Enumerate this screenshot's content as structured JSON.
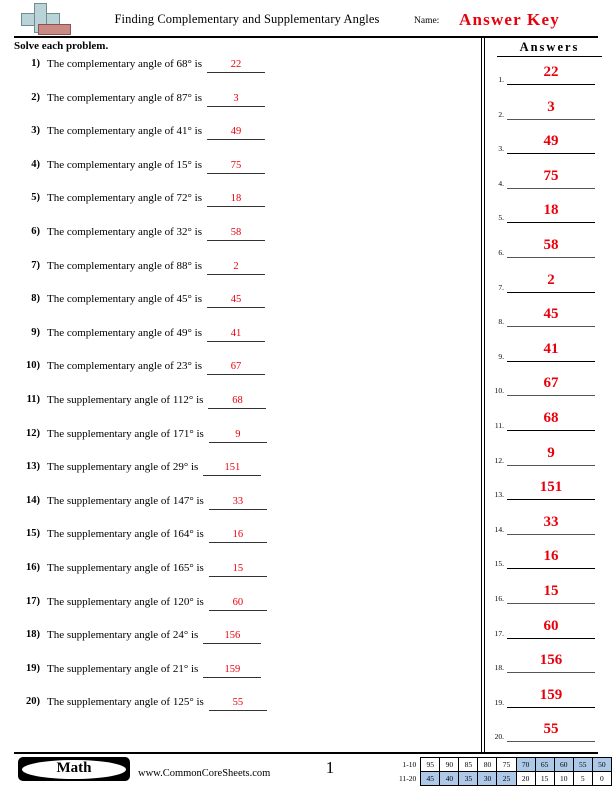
{
  "header": {
    "title": "Finding Complementary and Supplementary Angles",
    "name_label": "Name:",
    "name_value": "Answer Key",
    "logo_name": "commoncoresheets-plus-logo"
  },
  "subheader": {
    "instructions": "Solve each problem.",
    "answers_heading": "Answers"
  },
  "problems": [
    {
      "num": "1)",
      "text": "The complementary angle of 68° is",
      "answer": "22"
    },
    {
      "num": "2)",
      "text": "The complementary angle of 87° is",
      "answer": "3"
    },
    {
      "num": "3)",
      "text": "The complementary angle of 41° is",
      "answer": "49"
    },
    {
      "num": "4)",
      "text": "The complementary angle of 15° is",
      "answer": "75"
    },
    {
      "num": "5)",
      "text": "The complementary angle of 72° is",
      "answer": "18"
    },
    {
      "num": "6)",
      "text": "The complementary angle of 32° is",
      "answer": "58"
    },
    {
      "num": "7)",
      "text": "The complementary angle of 88° is",
      "answer": "2"
    },
    {
      "num": "8)",
      "text": "The complementary angle of 45° is",
      "answer": "45"
    },
    {
      "num": "9)",
      "text": "The complementary angle of 49° is",
      "answer": "41"
    },
    {
      "num": "10)",
      "text": "The complementary angle of 23° is",
      "answer": "67"
    },
    {
      "num": "11)",
      "text": "The supplementary angle of 112° is",
      "answer": "68"
    },
    {
      "num": "12)",
      "text": "The supplementary angle of 171° is",
      "answer": "9"
    },
    {
      "num": "13)",
      "text": "The supplementary angle of 29° is",
      "answer": "151"
    },
    {
      "num": "14)",
      "text": "The supplementary angle of 147° is",
      "answer": "33"
    },
    {
      "num": "15)",
      "text": "The supplementary angle of 164° is",
      "answer": "16"
    },
    {
      "num": "16)",
      "text": "The supplementary angle of 165° is",
      "answer": "15"
    },
    {
      "num": "17)",
      "text": "The supplementary angle of 120° is",
      "answer": "60"
    },
    {
      "num": "18)",
      "text": "The supplementary angle of 24° is",
      "answer": "156"
    },
    {
      "num": "19)",
      "text": "The supplementary angle of 21° is",
      "answer": "159"
    },
    {
      "num": "20)",
      "text": "The supplementary angle of 125° is",
      "answer": "55"
    }
  ],
  "answer_column": [
    {
      "num": "1.",
      "value": "22"
    },
    {
      "num": "2.",
      "value": "3"
    },
    {
      "num": "3.",
      "value": "49"
    },
    {
      "num": "4.",
      "value": "75"
    },
    {
      "num": "5.",
      "value": "18"
    },
    {
      "num": "6.",
      "value": "58"
    },
    {
      "num": "7.",
      "value": "2"
    },
    {
      "num": "8.",
      "value": "45"
    },
    {
      "num": "9.",
      "value": "41"
    },
    {
      "num": "10.",
      "value": "67"
    },
    {
      "num": "11.",
      "value": "68"
    },
    {
      "num": "12.",
      "value": "9"
    },
    {
      "num": "13.",
      "value": "151"
    },
    {
      "num": "14.",
      "value": "33"
    },
    {
      "num": "15.",
      "value": "16"
    },
    {
      "num": "16.",
      "value": "15"
    },
    {
      "num": "17.",
      "value": "60"
    },
    {
      "num": "18.",
      "value": "156"
    },
    {
      "num": "19.",
      "value": "159"
    },
    {
      "num": "20.",
      "value": "55"
    }
  ],
  "footer": {
    "subject_badge": "Math",
    "site_url": "www.CommonCoreSheets.com",
    "page_number": "1"
  },
  "score_table": {
    "row1_label": "1-10",
    "row2_label": "11-20",
    "row1": [
      {
        "value": "95",
        "highlighted": false
      },
      {
        "value": "90",
        "highlighted": false
      },
      {
        "value": "85",
        "highlighted": false
      },
      {
        "value": "80",
        "highlighted": false
      },
      {
        "value": "75",
        "highlighted": false
      },
      {
        "value": "70",
        "highlighted": true
      },
      {
        "value": "65",
        "highlighted": true
      },
      {
        "value": "60",
        "highlighted": true
      },
      {
        "value": "55",
        "highlighted": true
      },
      {
        "value": "50",
        "highlighted": true
      }
    ],
    "row2": [
      {
        "value": "45",
        "highlighted": true
      },
      {
        "value": "40",
        "highlighted": true
      },
      {
        "value": "35",
        "highlighted": true
      },
      {
        "value": "30",
        "highlighted": true
      },
      {
        "value": "25",
        "highlighted": true
      },
      {
        "value": "20",
        "highlighted": false
      },
      {
        "value": "15",
        "highlighted": false
      },
      {
        "value": "10",
        "highlighted": false
      },
      {
        "value": "5",
        "highlighted": false
      },
      {
        "value": "0",
        "highlighted": false
      }
    ]
  },
  "colors": {
    "answer_red": "#e8000d",
    "highlight_blue": "#aec9e8"
  }
}
